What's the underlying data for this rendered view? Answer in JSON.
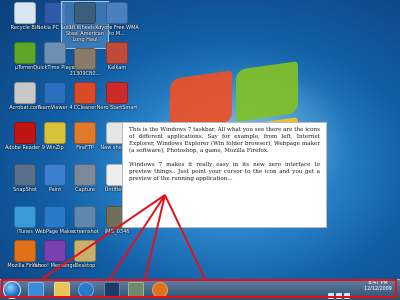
{
  "callout": {
    "paragraph1": "This is the Windows 7 taskbar. All what you see there are the icons of different applications. Say for example, from left, Internet Explorer, Windows Explorer (Win folder browser), Webpage maker (a software), Photoshop, a game, Mozilla Firefox.",
    "paragraph2": "Windows 7 makes it really easy in its new zero interface to preview things.. Just point your cursor to the icon and you get a preview of the running application..."
  },
  "desktop_icons": [
    {
      "label": "Recycle Bin",
      "icon": "recycle-bin-icon",
      "color": "#d9e6f2"
    },
    {
      "label": "Nokia PC Suite",
      "icon": "nokia-pc-suite-icon",
      "color": "#2e5aa8"
    },
    {
      "label": "18 Wheels of Steel American Long Haul",
      "icon": "truck-game-icon",
      "color": "#3b5f7d"
    },
    {
      "label": "Koyote Free WMA to M...",
      "icon": "converter-icon",
      "color": "#4a7fc0"
    },
    {
      "label": "µTorrent",
      "icon": "utorrent-icon",
      "color": "#5aa52a"
    },
    {
      "label": "QuickTime Player",
      "icon": "quicktime-icon",
      "color": "#6f8fb2"
    },
    {
      "label": "21309CB0...",
      "icon": "image-file-icon",
      "color": "#8a7a6a"
    },
    {
      "label": "Kalkam",
      "icon": "kalkam-icon",
      "color": "#c04a3a"
    },
    {
      "label": "Acrobat.com",
      "icon": "acrobat-com-icon",
      "color": "#c8c8c8"
    },
    {
      "label": "TeamViewer 4",
      "icon": "teamviewer-icon",
      "color": "#2b6fbf"
    },
    {
      "label": "CCleaner",
      "icon": "ccleaner-icon",
      "color": "#d84a2a"
    },
    {
      "label": "Nero StartSmart",
      "icon": "nero-icon",
      "color": "#cc2a2a"
    },
    {
      "label": "Adobe Reader 9",
      "icon": "adobe-reader-icon",
      "color": "#c01414"
    },
    {
      "label": "WinZip",
      "icon": "winzip-icon",
      "color": "#d8c23a"
    },
    {
      "label": "FireFTP",
      "icon": "fireftp-icon",
      "color": "#e07a2a"
    },
    {
      "label": "New shortcut",
      "icon": "shortcut-icon",
      "color": "#e6e6e6"
    },
    {
      "label": "SnapShot",
      "icon": "snapshot-icon",
      "color": "#5a6f8a"
    },
    {
      "label": "Paint",
      "icon": "paint-icon",
      "color": "#3a7fd0"
    },
    {
      "label": "Capture",
      "icon": "capture-icon",
      "color": "#7a8a9a"
    },
    {
      "label": "Untitled 1",
      "icon": "document-icon",
      "color": "#eeeeee"
    },
    {
      "label": "iTunes",
      "icon": "itunes-icon",
      "color": "#3a9ad8"
    },
    {
      "label": "WebPage Maker",
      "icon": "webpage-maker-icon",
      "color": "#2a7acc"
    },
    {
      "label": "screenshot",
      "icon": "screenshot-file-icon",
      "color": "#5f87b0"
    },
    {
      "label": "IMG_0346",
      "icon": "photo-file-icon",
      "color": "#6f6f5a"
    },
    {
      "label": "Mozilla Firefox",
      "icon": "firefox-icon",
      "color": "#e0701a"
    },
    {
      "label": "Yahoo! Messenger",
      "icon": "yahoo-messenger-icon",
      "color": "#7a3fb0"
    },
    {
      "label": "Desktop",
      "icon": "desktop-folder-icon",
      "color": "#c9b06a"
    }
  ],
  "taskbar": {
    "time": "8:47 PM",
    "date": "12/12/2009",
    "start_icon": "windows-orb-icon",
    "items": [
      {
        "icon": "internet-explorer-icon",
        "color": "#3a8ad8"
      },
      {
        "icon": "windows-explorer-icon",
        "color": "#e8c35a"
      },
      {
        "icon": "webpage-maker-icon",
        "color": "#2a7acc"
      },
      {
        "icon": "photoshop-icon",
        "color": "#1c3a66"
      },
      {
        "icon": "game-icon",
        "color": "#6f8a6a"
      },
      {
        "icon": "firefox-icon",
        "color": "#e0701a"
      }
    ]
  },
  "colors": {
    "highlight": "#e0121b",
    "taskbar": "#2e4a6b"
  }
}
